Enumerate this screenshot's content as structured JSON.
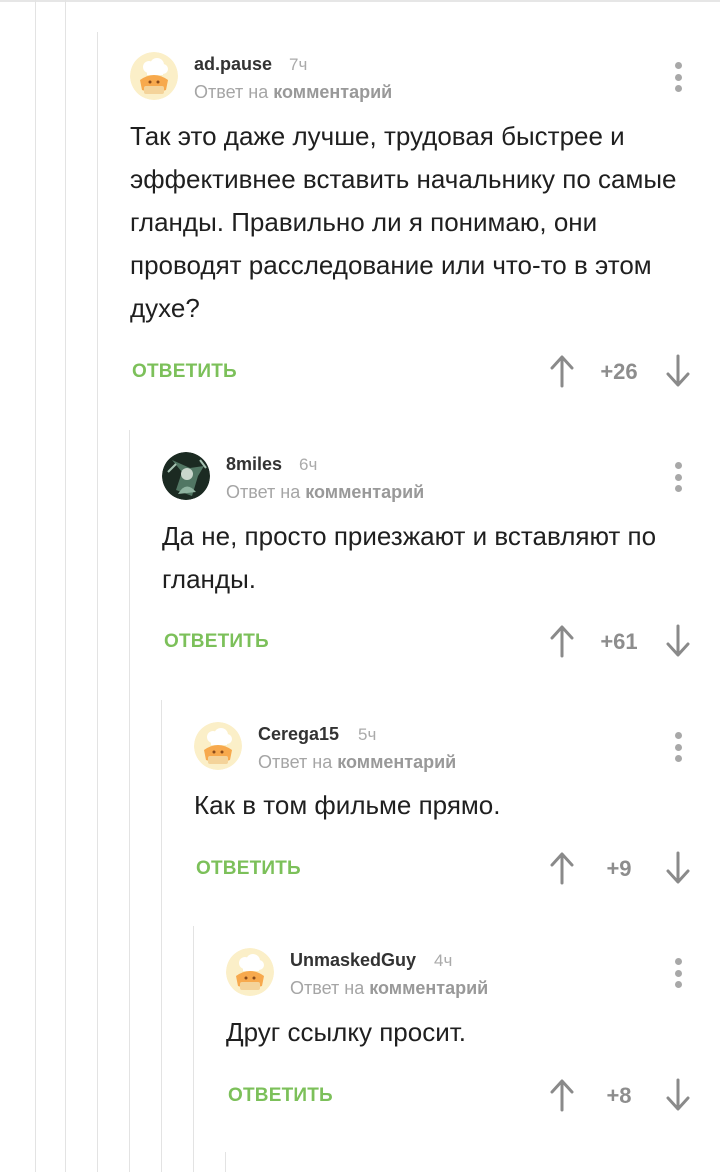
{
  "comments": [
    {
      "username": "ad.pause",
      "time": "7ч",
      "reply_prefix": "Ответ на",
      "reply_target": "комментарий",
      "text": "Так это даже лучше, трудовая быстрее и эффективнее вставить начальнику по самые гланды. Правильно ли я понимаю, они проводят расследование или что-то в этом духе?",
      "reply_label": "ОТВЕТИТЬ",
      "score": "+26",
      "avatar": "chef-cupcake-avatar"
    },
    {
      "username": "8miles",
      "time": "6ч",
      "reply_prefix": "Ответ на",
      "reply_target": "комментарий",
      "text": "Да не, просто приезжают и вставляют по гланды.",
      "reply_label": "ОТВЕТИТЬ",
      "score": "+61",
      "avatar": "dark-photo-avatar"
    },
    {
      "username": "Cerega15",
      "time": "5ч",
      "reply_prefix": "Ответ на",
      "reply_target": "комментарий",
      "text": "Как в том фильме прямо.",
      "reply_label": "ОТВЕТИТЬ",
      "score": "+9",
      "avatar": "chef-cupcake-avatar"
    },
    {
      "username": "UnmaskedGuy",
      "time": "4ч",
      "reply_prefix": "Ответ на",
      "reply_target": "комментарий",
      "text": "Друг ссылку просит.",
      "reply_label": "ОТВЕТИТЬ",
      "score": "+8",
      "avatar": "chef-cupcake-avatar"
    }
  ],
  "colors": {
    "reply_green": "#7cc05a",
    "meta_gray": "#a5a5a5",
    "thread_line": "#e3e3e3"
  },
  "icons": [
    "more-vertical-icon",
    "arrow-up-icon",
    "arrow-down-icon"
  ]
}
